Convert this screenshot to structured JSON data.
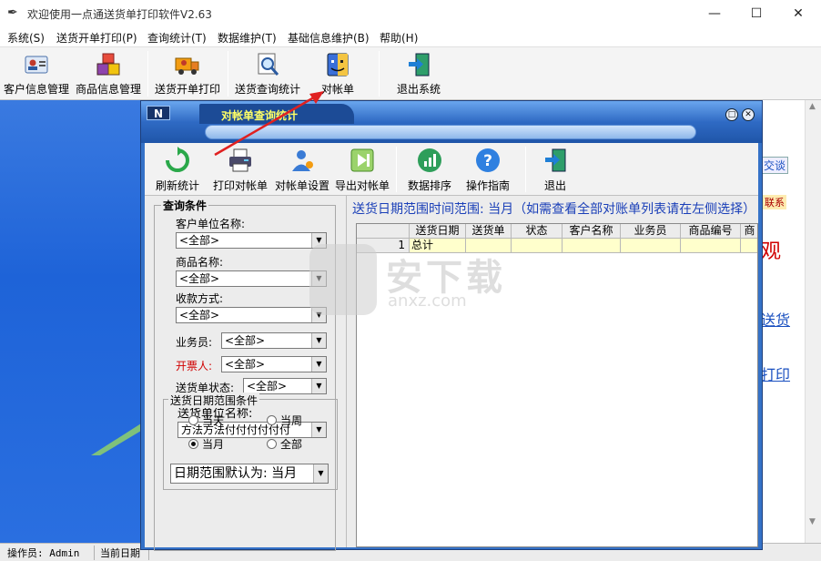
{
  "window": {
    "title": "欢迎使用一点通送货单打印软件V2.63",
    "minimize": "—",
    "maximize": "☐",
    "close": "✕"
  },
  "menu": [
    "系统(S)",
    "送货开单打印(P)",
    "查询统计(T)",
    "数据维护(T)",
    "基础信息维护(B)",
    "帮助(H)"
  ],
  "toolbar": {
    "customer": "客户信息管理",
    "product": "商品信息管理",
    "delivery_order": "送货开单打印",
    "delivery_query": "送货查询统计",
    "statement": "对帐单",
    "exit": "退出系统"
  },
  "background_right": {
    "chat": "交谈",
    "contact": "联系",
    "red_char": "观",
    "link1": "送货",
    "link2": "打印"
  },
  "statusbar": {
    "operator": "操作员: Admin",
    "date": "当前日期"
  },
  "dialog": {
    "title": "对帐单查询统计",
    "logo": "N",
    "btn_restore": "□",
    "btn_close": "✕",
    "toolbar": {
      "refresh": "刷新统计",
      "print": "打印对帐单",
      "settings": "对帐单设置",
      "export": "导出对帐单",
      "sort": "数据排序",
      "guide": "操作指南",
      "exit": "退出"
    },
    "query": {
      "group_title": "查询条件",
      "customer_label": "客户单位名称:",
      "customer_value": "<全部>",
      "product_label": "商品名称:",
      "product_value": "<全部>",
      "payment_label": "收款方式:",
      "payment_value": "<全部>",
      "salesman_label": "业务员:",
      "salesman_value": "<全部>",
      "drawer_label": "开票人:",
      "drawer_value": "<全部>",
      "status_label": "送货单状态:",
      "status_value": "<全部>",
      "unit_label": "送货单位名称:",
      "unit_value": "方法方法付付付付付付",
      "date_group_title": "送货日期范围条件",
      "radio_today": "当天",
      "radio_week": "当周",
      "radio_month": "当月",
      "radio_all": "全部",
      "date_default": "日期范围默认为: 当月"
    },
    "info": "送货日期范围时间范围: 当月（如需查看全部对账单列表请在左侧选择）",
    "grid": {
      "columns": [
        "",
        "送货日期",
        "送货单",
        "状态",
        "客户名称",
        "业务员",
        "商品编号",
        "商"
      ],
      "rows": [
        [
          "1",
          "总计",
          "",
          "",
          "",
          "",
          "",
          ""
        ]
      ]
    }
  },
  "watermark": {
    "text": "安下载",
    "url": "anxz.com"
  },
  "colors": {
    "dialog_blue": "#3572c8",
    "title_yellow": "#ffff66",
    "info_blue": "#1a3fb8",
    "total_row": "#ffffcc",
    "arrow_red": "#e02020"
  }
}
